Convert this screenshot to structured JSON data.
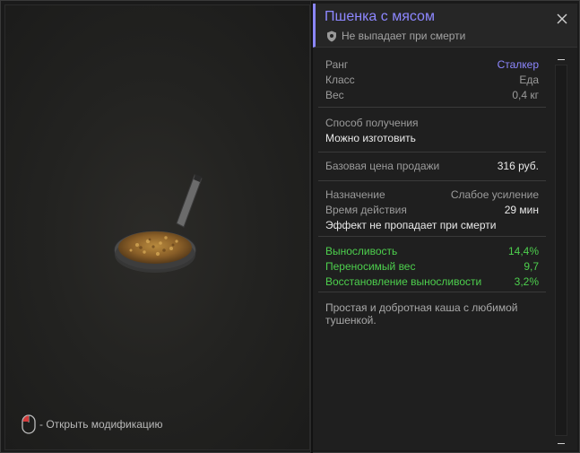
{
  "item": {
    "title": "Пшенка с мясом",
    "drop_status": "Не выпадает при смерти"
  },
  "preview": {
    "mod_hint": "- Открыть модификацию"
  },
  "stats": {
    "rank_label": "Ранг",
    "rank_value": "Сталкер",
    "class_label": "Класс",
    "class_value": "Еда",
    "weight_label": "Вес",
    "weight_value": "0,4 кг"
  },
  "obtain": {
    "label": "Способ получения",
    "value": "Можно изготовить"
  },
  "price": {
    "label": "Базовая цена продажи",
    "value": "316 руб."
  },
  "purpose": {
    "label": "Назначение",
    "value": "Слабое усиление",
    "duration_label": "Время действия",
    "duration_value": "29 мин",
    "note": "Эффект не пропадает при смерти"
  },
  "effects": [
    {
      "label": "Выносливость",
      "value": "14,4%"
    },
    {
      "label": "Переносимый вес",
      "value": "9,7"
    },
    {
      "label": "Восстановление выносливости",
      "value": "3,2%"
    }
  ],
  "description": "Простая и добротная каша с любимой тушенкой.",
  "colors": {
    "accent": "#8d87ff",
    "positive": "#4dcf4d"
  },
  "icons": {
    "close": "close-icon",
    "shield": "shield-icon",
    "mouse": "mouse-icon"
  }
}
